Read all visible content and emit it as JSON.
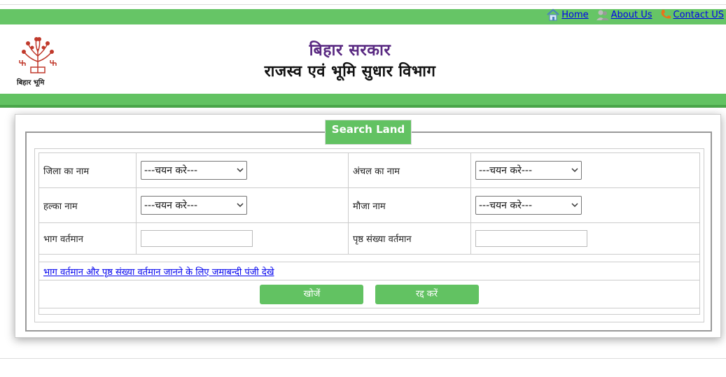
{
  "nav": {
    "home": "Home",
    "about": "About Us",
    "contact": "Contact US"
  },
  "header": {
    "title_primary": "बिहार सरकार",
    "title_secondary": "राजस्व एवं भूमि सुधार विभाग",
    "logo_text": "बिहार भूमि"
  },
  "form": {
    "legend": "Search Land",
    "district_label": "जिला का नाम",
    "district_value": "---चयन करे---",
    "circle_label": "अंचल का नाम",
    "circle_value": "---चयन करे---",
    "halka_label": "हल्का नाम",
    "halka_value": "---चयन करे---",
    "mauja_label": "मौजा नाम",
    "mauja_value": "---चयन करे---",
    "bhag_label": "भाग वर्तमान",
    "bhag_value": "",
    "page_label": "पृष्ठ संख्या वर्तमान",
    "page_value": "",
    "help_link": "भाग वर्तमान और पृष्ठ संख्या वर्तमान जानने के लिए जमाबन्दी पंजी देखे",
    "search_button": "खोजें",
    "cancel_button": "रद्द करें"
  },
  "colors": {
    "green": "#62c262",
    "title_purple": "#5a2a82"
  }
}
